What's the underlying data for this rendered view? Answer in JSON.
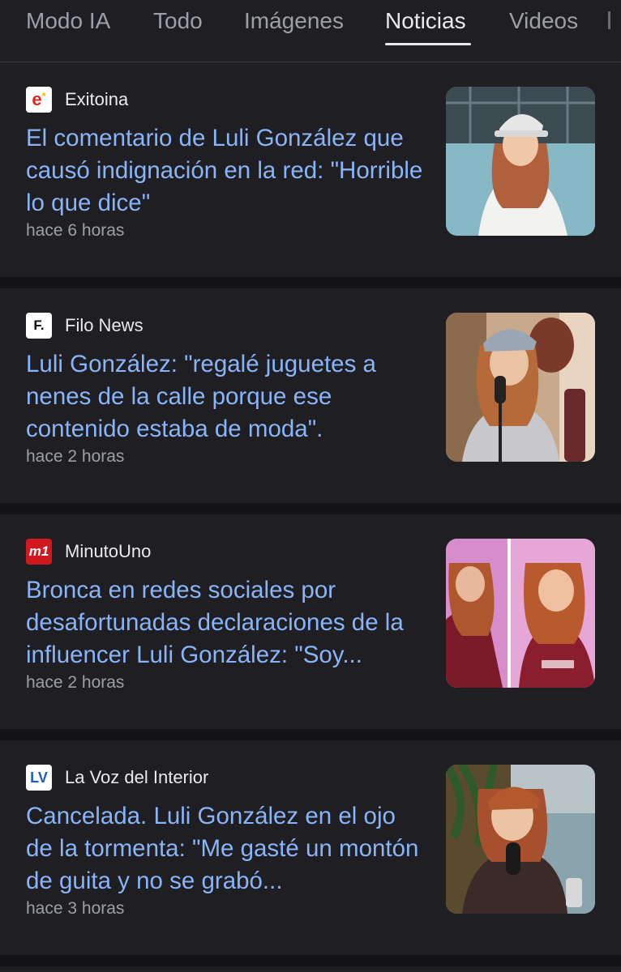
{
  "tabs": [
    {
      "label": "Modo IA"
    },
    {
      "label": "Todo"
    },
    {
      "label": "Imágenes"
    },
    {
      "label": "Noticias"
    },
    {
      "label": "Videos"
    }
  ],
  "active_tab": "Noticias",
  "articles": [
    {
      "source": "Exitoina",
      "favicon_text": "e",
      "headline": "El comentario de Luli González que causó indignación en la red: \"Horrible lo que dice\"",
      "time": "hace 6 horas"
    },
    {
      "source": "Filo News",
      "favicon_text": "F.",
      "headline": "Luli González: \"regalé juguetes a nenes de la calle porque ese contenido estaba de moda\".",
      "time": "hace 2 horas"
    },
    {
      "source": "MinutoUno",
      "favicon_text": "m1",
      "headline": "Bronca en redes sociales por desafortunadas declaraciones de la influencer Luli González: \"Soy...",
      "time": "hace 2 horas"
    },
    {
      "source": "La Voz del Interior",
      "favicon_text": "LV",
      "headline": "Cancelada. Luli González en el ojo de la tormenta: \"Me gasté un montón de guita y no se grabó...",
      "time": "hace 3 horas"
    }
  ],
  "colors": {
    "background": "#1f1f23",
    "separator": "#131316",
    "link": "#8ab4f8",
    "muted": "#9aa0a6",
    "text": "#e8eaed"
  }
}
